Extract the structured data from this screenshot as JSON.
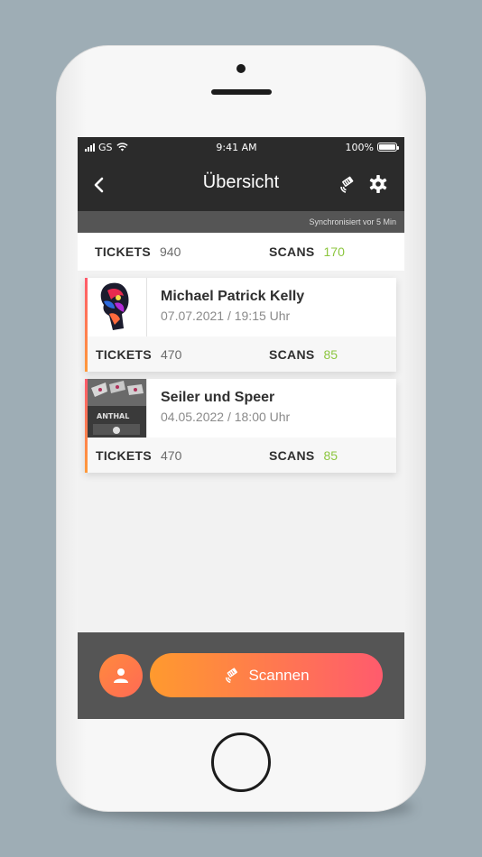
{
  "status_bar": {
    "carrier": "GS",
    "time": "9:41 AM",
    "battery": "100%"
  },
  "nav": {
    "title": "Übersicht"
  },
  "sync": {
    "text": "Synchronisiert vor 5 Min"
  },
  "totals": {
    "tickets_label": "TICKETS",
    "tickets_value": "940",
    "scans_label": "SCANS",
    "scans_value": "170"
  },
  "events": [
    {
      "name": "Michael Patrick Kelly",
      "date": "07.07.2021 / 19:15 Uhr",
      "tickets_label": "TICKETS",
      "tickets_value": "470",
      "scans_label": "SCANS",
      "scans_value": "85"
    },
    {
      "name": "Seiler und Speer",
      "date": "04.05.2022 / 18:00 Uhr",
      "tickets_label": "TICKETS",
      "tickets_value": "470",
      "scans_label": "SCANS",
      "scans_value": "85"
    }
  ],
  "bottom": {
    "scan_label": "Scannen"
  },
  "colors": {
    "accent_green": "#8cc63f",
    "gradient_start": "#ff9a2e",
    "gradient_end": "#ff5b6d",
    "navbar": "#2b2b2b",
    "bar_gray": "#555555"
  }
}
